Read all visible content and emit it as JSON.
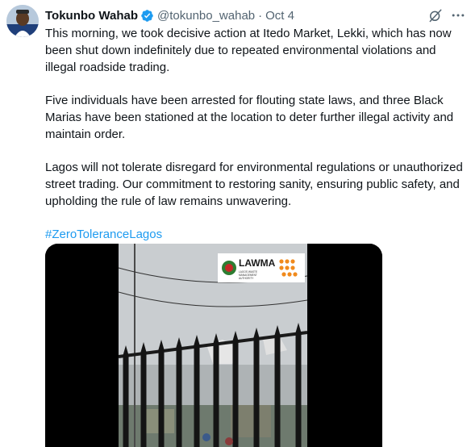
{
  "author": {
    "name": "Tokunbo Wahab",
    "handle": "@tokunbo_wahab",
    "separator": "·",
    "date": "Oct 4"
  },
  "icons": {
    "verified": "verified-badge-icon",
    "grok": "grok-icon",
    "more": "more-options-icon"
  },
  "tweet": {
    "paragraphs": [
      "This morning, we took decisive action at Itedo Market, Lekki, which has now been shut down indefinitely due to repeated environmental violations and illegal roadside trading.",
      "Five individuals have been arrested for flouting state laws, and three Black Marias have been stationed at the location to deter further illegal activity and maintain order.",
      "Lagos will not tolerate disregard for environmental regulations or unauthorized street trading. Our commitment to restoring sanity, ensuring public safety, and upholding the rule of law remains unwavering."
    ],
    "hashtag": "#ZeroToleranceLagos"
  },
  "media": {
    "logo_text": "LAWMA",
    "logo_subtext": "LAGOS WASTE MANAGEMENT AUTHORITY"
  },
  "colors": {
    "text": "#0f1419",
    "muted": "#536471",
    "link": "#1d9bf0",
    "verified": "#1d9bf0",
    "lawma_orange": "#f08a1c"
  }
}
